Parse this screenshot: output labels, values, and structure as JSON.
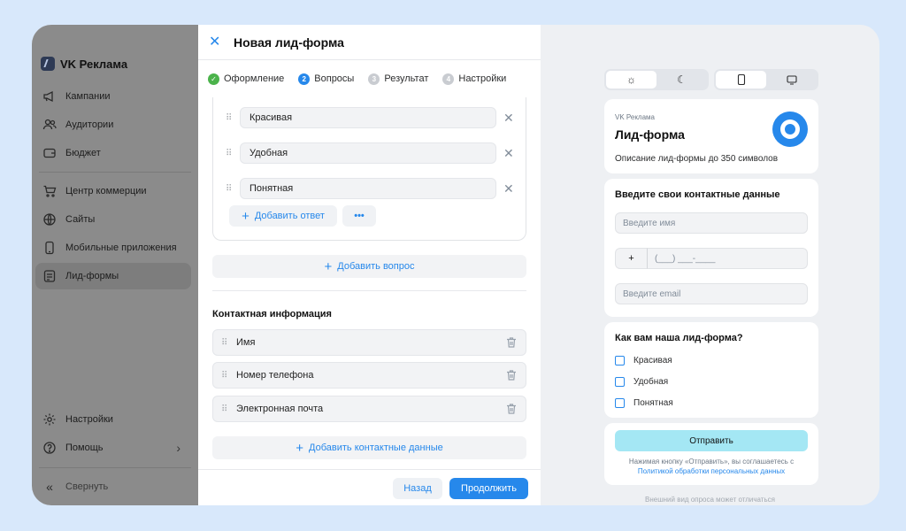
{
  "sidebar": {
    "brand": "VK Реклама",
    "items": [
      {
        "label": "Кампании",
        "icon": "megaphone-icon"
      },
      {
        "label": "Аудитории",
        "icon": "users-icon"
      },
      {
        "label": "Бюджет",
        "icon": "wallet-icon"
      },
      {
        "label": "Центр коммерции",
        "icon": "cart-icon"
      },
      {
        "label": "Сайты",
        "icon": "globe-icon"
      },
      {
        "label": "Мобильные приложения",
        "icon": "smartphone-icon"
      },
      {
        "label": "Лид-формы",
        "icon": "form-icon",
        "active": true
      }
    ],
    "settings": "Настройки",
    "help": "Помощь",
    "collapse": "Свернуть"
  },
  "header": {
    "title": "Новая лид-форма"
  },
  "steps": [
    {
      "num": "✓",
      "label": "Оформление",
      "state": "done"
    },
    {
      "num": "2",
      "label": "Вопросы",
      "state": "current"
    },
    {
      "num": "3",
      "label": "Результат",
      "state": "pending"
    },
    {
      "num": "4",
      "label": "Настройки",
      "state": "pending"
    }
  ],
  "question": {
    "answers": [
      "Красивая",
      "Удобная",
      "Понятная"
    ],
    "add_answer": "Добавить ответ",
    "more": "•••"
  },
  "add_question": "Добавить вопрос",
  "contacts": {
    "title": "Контактная информация",
    "fields": [
      "Имя",
      "Номер телефона",
      "Электронная почта"
    ],
    "add": "Добавить контактные данные"
  },
  "footer": {
    "back": "Назад",
    "next": "Продолжить"
  },
  "preview": {
    "brand": "VK Реклама",
    "title": "Лид-форма",
    "description": "Описание лид-формы до 350 символов",
    "contact_title": "Введите свои контактные данные",
    "name_placeholder": "Введите имя",
    "phone_prefix": "+",
    "phone_placeholder": "(___) ___-____",
    "email_placeholder": "Введите email",
    "question_title": "Как вам наша лид-форма?",
    "options": [
      "Красивая",
      "Удобная",
      "Понятная"
    ],
    "submit": "Отправить",
    "legal_text": "Нажимая кнопку «Отправить», вы соглашаетесь с",
    "legal_link": "Политикой обработки персональных данных",
    "note": "Внешний вид опроса может отличаться"
  },
  "colors": {
    "accent": "#2688eb",
    "submit": "#a4e7f4",
    "done": "#4bb34b"
  }
}
